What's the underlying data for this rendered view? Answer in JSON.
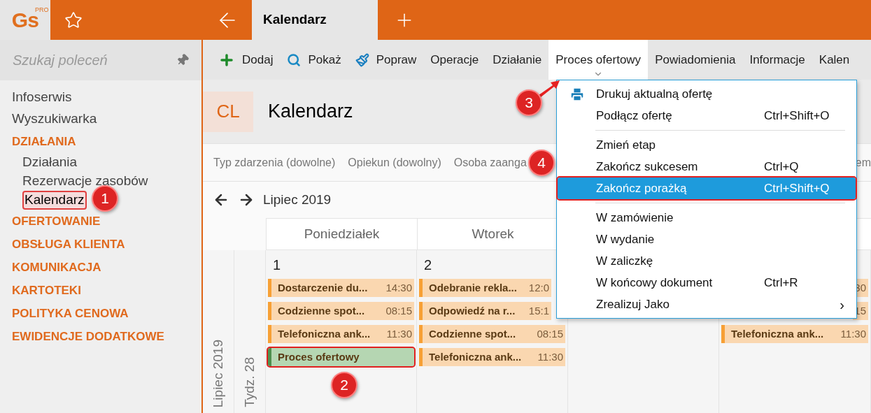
{
  "app": {
    "logo": "Gs",
    "logo_badge": "PRO"
  },
  "tabs": [
    {
      "label": "Kalendarz",
      "selected": true
    }
  ],
  "sidebar": {
    "search": {
      "placeholder": "Szukaj poleceń"
    },
    "items": [
      {
        "kind": "link",
        "label": "Infoserwis",
        "selected": false,
        "highlighted": false
      },
      {
        "kind": "link",
        "label": "Wyszukiwarka",
        "selected": false,
        "highlighted": false
      },
      {
        "kind": "section",
        "label": "DZIAŁANIA",
        "children": [
          {
            "label": "Działania",
            "selected": false,
            "highlighted": false
          },
          {
            "label": "Rezerwacje zasobów",
            "selected": false,
            "highlighted": false
          },
          {
            "label": "Kalendarz",
            "selected": true,
            "highlighted": true
          }
        ]
      },
      {
        "kind": "section",
        "label": "OFERTOWANIE"
      },
      {
        "kind": "section",
        "label": "OBSŁUGA KLIENTA"
      },
      {
        "kind": "section",
        "label": "KOMUNIKACJA"
      },
      {
        "kind": "section",
        "label": "KARTOTEKI"
      },
      {
        "kind": "section",
        "label": "POLITYKA CENOWA"
      },
      {
        "kind": "section",
        "label": "EWIDENCJE DODATKOWE"
      }
    ]
  },
  "toolbar": [
    {
      "kind": "add",
      "label": "Dodaj",
      "selected": false
    },
    {
      "kind": "search",
      "label": "Pokaż",
      "selected": false
    },
    {
      "kind": "edit",
      "label": "Popraw",
      "selected": false
    },
    {
      "kind": "text",
      "label": "Operacje",
      "selected": false
    },
    {
      "kind": "text",
      "label": "Działanie",
      "selected": false
    },
    {
      "kind": "text",
      "label": "Proces ofertowy",
      "selected": true
    },
    {
      "kind": "text",
      "label": "Powiadomienia",
      "selected": false
    },
    {
      "kind": "text",
      "label": "Informacje",
      "selected": false
    },
    {
      "kind": "text",
      "label": "Kalen",
      "selected": false
    }
  ],
  "header": {
    "badge": "CL",
    "title": "Kalendarz"
  },
  "filters": [
    "Typ zdarzenia (dowolne)",
    "Opiekun (dowolny)",
    "Osoba zaanga"
  ],
  "filter_tail": "em",
  "calendar": {
    "period": "Lipiec 2019",
    "month_label": "Lipiec 2019",
    "week_label": "Tydz. 28",
    "columns": [
      "Poniedziałek",
      "Wtorek"
    ],
    "days": [
      {
        "number": "1",
        "events": [
          {
            "kind": "task",
            "title": "Dostarczenie du...",
            "time": "14:30",
            "highlighted": false
          },
          {
            "kind": "task",
            "title": "Codzienne spot...",
            "time": "08:15",
            "highlighted": false
          },
          {
            "kind": "task",
            "title": "Telefoniczna ank...",
            "time": "11:30",
            "highlighted": false
          },
          {
            "kind": "process",
            "title": "Proces ofertowy",
            "highlighted": true
          }
        ]
      },
      {
        "number": "2",
        "events": [
          {
            "kind": "task",
            "title": "Odebranie rekla...",
            "time": "12:0",
            "highlighted": false
          },
          {
            "kind": "task",
            "title": "Odpowiedź na r...",
            "time": "15:1",
            "highlighted": false
          },
          {
            "kind": "task",
            "title": "Codzienne spot...",
            "time": "08:15",
            "highlighted": false
          },
          {
            "kind": "task",
            "title": "Telefoniczna ank...",
            "time": "11:30",
            "highlighted": false
          }
        ]
      },
      {
        "events": [
          {
            "kind": "task",
            "time": "30",
            "highlighted": false
          },
          {
            "kind": "task",
            "time": "15",
            "highlighted": false
          },
          {
            "kind": "task",
            "title": "Telefoniczna ank...",
            "time": "11:30",
            "highlighted": false
          }
        ]
      }
    ]
  },
  "menu": [
    {
      "kind": "print",
      "label": "Drukuj aktualną ofertę",
      "selected": false,
      "highlighted": false
    },
    {
      "kind": "item",
      "label": "Podłącz ofertę",
      "shortcut": "Ctrl+Shift+O",
      "selected": false,
      "highlighted": false
    },
    {
      "kind": "separator"
    },
    {
      "kind": "item",
      "label": "Zmień etap",
      "selected": false,
      "highlighted": false
    },
    {
      "kind": "item",
      "label": "Zakończ sukcesem",
      "shortcut": "Ctrl+Q",
      "selected": false,
      "highlighted": false
    },
    {
      "kind": "item",
      "label": "Zakończ porażką",
      "shortcut": "Ctrl+Shift+Q",
      "selected": true,
      "highlighted": true
    },
    {
      "kind": "separator"
    },
    {
      "kind": "item",
      "label": "W zamówienie",
      "selected": false,
      "highlighted": false
    },
    {
      "kind": "item",
      "label": "W wydanie",
      "selected": false,
      "highlighted": false
    },
    {
      "kind": "item",
      "label": "W zaliczkę",
      "selected": false,
      "highlighted": false
    },
    {
      "kind": "item",
      "label": "W końcowy dokument",
      "shortcut": "Ctrl+R",
      "selected": false,
      "highlighted": false
    },
    {
      "kind": "submenu",
      "label": "Zrealizuj Jako",
      "arrow": "›",
      "selected": false,
      "highlighted": false
    }
  ],
  "annotations": [
    {
      "number": "1",
      "pointer": false
    },
    {
      "number": "2",
      "pointer": false
    },
    {
      "number": "3",
      "pointer": true
    },
    {
      "number": "4",
      "pointer": false
    }
  ]
}
